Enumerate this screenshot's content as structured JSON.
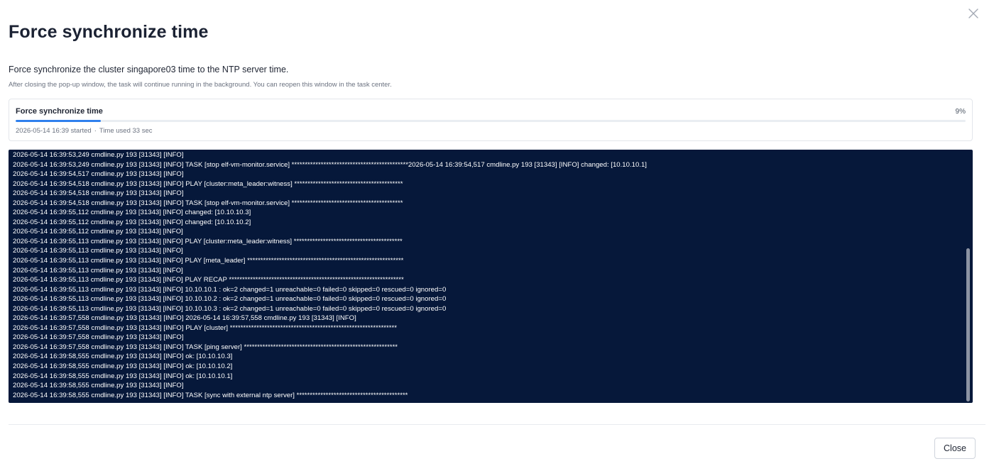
{
  "dialog": {
    "title": "Force synchronize time",
    "description": "Force synchronize the cluster singapore03 time to the NTP server time.",
    "note": "After closing the pop-up window, the task will continue running in the background. You can reopen this window in the task center.",
    "close_icon": "close-icon"
  },
  "task": {
    "name": "Force synchronize time",
    "progress_label": "9%",
    "progress": 0.09,
    "started": "2026-05-14 16:39 started",
    "separator": "·",
    "time_used": "Time used 33 sec",
    "accent_color": "#2f80ed"
  },
  "log": {
    "background": "#06183a",
    "lines": [
      "2026-05-14 16:39:53,249 cmdline.py 193 [31343] [INFO]",
      "2026-05-14 16:39:53,249 cmdline.py 193 [31343] [INFO] TASK [stop elf-vm-monitor.service] ********************************************2026-05-14 16:39:54,517 cmdline.py 193 [31343] [INFO] changed: [10.10.10.1]",
      "2026-05-14 16:39:54,517 cmdline.py 193 [31343] [INFO]",
      "2026-05-14 16:39:54,518 cmdline.py 193 [31343] [INFO] PLAY [cluster:meta_leader:witness] *****************************************",
      "2026-05-14 16:39:54,518 cmdline.py 193 [31343] [INFO]",
      "2026-05-14 16:39:54,518 cmdline.py 193 [31343] [INFO] TASK [stop elf-vm-monitor.service] ******************************************",
      "2026-05-14 16:39:55,112 cmdline.py 193 [31343] [INFO] changed: [10.10.10.3]",
      "2026-05-14 16:39:55,112 cmdline.py 193 [31343] [INFO] changed: [10.10.10.2]",
      "2026-05-14 16:39:55,112 cmdline.py 193 [31343] [INFO]",
      "2026-05-14 16:39:55,113 cmdline.py 193 [31343] [INFO] PLAY [cluster:meta_leader:witness] *****************************************",
      "2026-05-14 16:39:55,113 cmdline.py 193 [31343] [INFO]",
      "2026-05-14 16:39:55,113 cmdline.py 193 [31343] [INFO] PLAY [meta_leader] ***********************************************************",
      "2026-05-14 16:39:55,113 cmdline.py 193 [31343] [INFO]",
      "2026-05-14 16:39:55,113 cmdline.py 193 [31343] [INFO] PLAY RECAP ******************************************************************",
      "2026-05-14 16:39:55,113 cmdline.py 193 [31343] [INFO] 10.10.10.1 : ok=2 changed=1 unreachable=0 failed=0 skipped=0 rescued=0 ignored=0",
      "2026-05-14 16:39:55,113 cmdline.py 193 [31343] [INFO] 10.10.10.2 : ok=2 changed=1 unreachable=0 failed=0 skipped=0 rescued=0 ignored=0",
      "2026-05-14 16:39:55,113 cmdline.py 193 [31343] [INFO] 10.10.10.3 : ok=2 changed=1 unreachable=0 failed=0 skipped=0 rescued=0 ignored=0",
      "2026-05-14 16:39:57,558 cmdline.py 193 [31343] [INFO] 2026-05-14 16:39:57,558 cmdline.py 193 [31343] [INFO]",
      "2026-05-14 16:39:57,558 cmdline.py 193 [31343] [INFO] PLAY [cluster] ***************************************************************",
      "2026-05-14 16:39:57,558 cmdline.py 193 [31343] [INFO]",
      "2026-05-14 16:39:57,558 cmdline.py 193 [31343] [INFO] TASK [ping server] **********************************************************",
      "2026-05-14 16:39:58,555 cmdline.py 193 [31343] [INFO] ok: [10.10.10.3]",
      "2026-05-14 16:39:58,555 cmdline.py 193 [31343] [INFO] ok: [10.10.10.2]",
      "2026-05-14 16:39:58,555 cmdline.py 193 [31343] [INFO] ok: [10.10.10.1]",
      "2026-05-14 16:39:58,555 cmdline.py 193 [31343] [INFO]",
      "2026-05-14 16:39:58,555 cmdline.py 193 [31343] [INFO] TASK [sync with external ntp server] ******************************************"
    ]
  },
  "footer": {
    "close_label": "Close"
  }
}
